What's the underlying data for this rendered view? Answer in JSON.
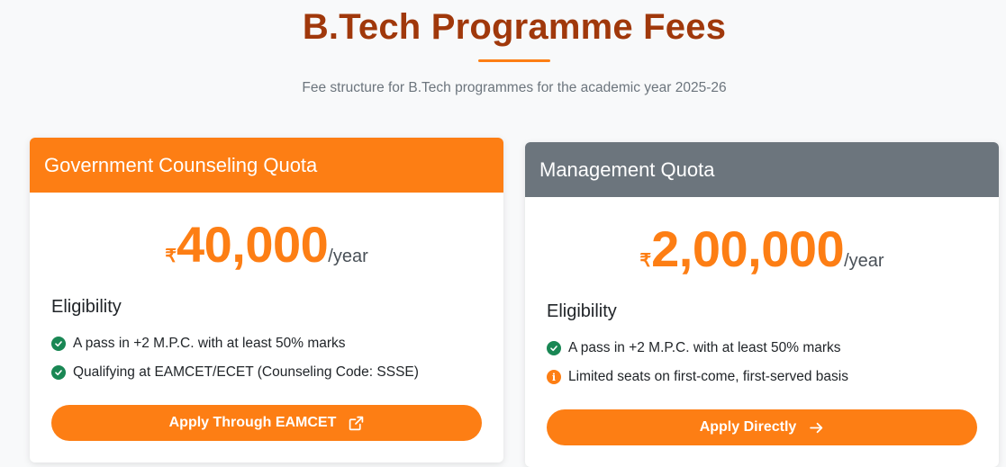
{
  "header": {
    "title": "B.Tech Programme Fees",
    "subtitle": "Fee structure for B.Tech programmes for the academic year 2025-26"
  },
  "colors": {
    "accent": "#fd7e14",
    "title": "#a0380b",
    "muted_header": "#6c757d",
    "check": "#198754"
  },
  "cards": [
    {
      "header": "Government Counseling Quota",
      "currency": "₹",
      "amount": "40,000",
      "period": "/year",
      "eligibility_heading": "Eligibility",
      "items": [
        {
          "icon": "check-circle-icon",
          "text": "A pass in +2 M.P.C. with at least 50% marks"
        },
        {
          "icon": "check-circle-icon",
          "text": "Qualifying at EAMCET/ECET (Counseling Code: SSSE)"
        }
      ],
      "button": {
        "label": "Apply Through EAMCET",
        "icon": "external-link-icon"
      }
    },
    {
      "header": "Management Quota",
      "currency": "₹",
      "amount": "2,00,000",
      "period": "/year",
      "eligibility_heading": "Eligibility",
      "items": [
        {
          "icon": "check-circle-icon",
          "text": "A pass in +2 M.P.C. with at least 50% marks"
        },
        {
          "icon": "info-circle-icon",
          "text": "Limited seats on first-come, first-served basis"
        }
      ],
      "button": {
        "label": "Apply Directly",
        "icon": "arrow-right-icon"
      }
    }
  ]
}
